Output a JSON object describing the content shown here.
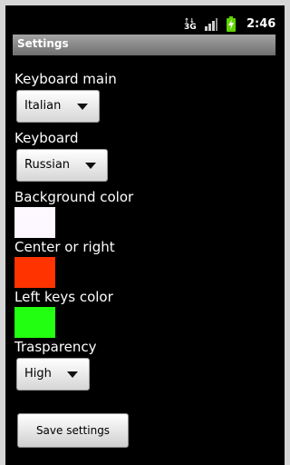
{
  "status_bar": {
    "signal_type": "3G",
    "time": "2:46",
    "icons": [
      "data-arrows-icon",
      "signal-bars-icon",
      "battery-charging-icon"
    ]
  },
  "title_bar": {
    "title": "Settings"
  },
  "settings": {
    "keyboard_main": {
      "label": "Keyboard main",
      "value": "Italian"
    },
    "keyboard": {
      "label": "Keyboard",
      "value": "Russian"
    },
    "background_color": {
      "label": "Background color",
      "color": "#fdf7ff"
    },
    "center_or_right": {
      "label": "Center or right",
      "color": "#ff3300"
    },
    "left_keys_color": {
      "label": "Left keys color",
      "color": "#22ff11"
    },
    "transparency": {
      "label": "Trasparency",
      "value": "High"
    }
  },
  "save_button": {
    "label": "Save settings"
  },
  "colors": {
    "background": "#000000",
    "title_bar_top": "#a3a3a3",
    "title_bar_bottom": "#6f6f6f",
    "battery": "#5fd400"
  }
}
